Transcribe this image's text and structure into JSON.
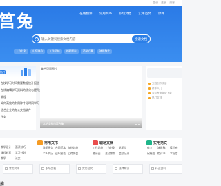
{
  "topbar": {
    "links": [
      "登录",
      "注册",
      "消息"
    ]
  },
  "header": {
    "logo": "筥兔",
    "nav": [
      "在线翻译",
      "常用文书",
      "职场文档",
      "实用范文",
      "课件"
    ]
  },
  "search": {
    "placeholder": "输入关键词搜索文档内容",
    "button_label": "搜索文档"
  },
  "hot_tags": [
    "工作计划",
    "心得体会",
    "工作总结",
    "述职报告",
    "活动方案",
    "演讲稿件"
  ],
  "left_panel": {
    "badge": "热门",
    "items": [
      "在校学习时间需要数据统计报告",
      "在线编辑学习资料的优化与提升方法",
      "教程",
      "如何高效的利用碎片化时间学习",
      "适合企业的办公文档软件",
      "任务"
    ]
  },
  "carousel": {
    "image_alt": "集合页面图片",
    "caption": "本站文档内容合集"
  },
  "right_panel": {
    "items": [
      "文档创作手册",
      "新手入门",
      "会员专享免费下载",
      "热门文档"
    ]
  },
  "categories": [
    {
      "title": "常用文书",
      "links": [
        "辞职报告",
        "合同范本",
        "年终总结",
        "个人简历",
        "述职报告",
        "心得体会"
      ]
    },
    {
      "title": "职场文档",
      "links": [
        "工作总结",
        "工作计划",
        "求职信",
        "邀请函",
        "活动策划",
        "会议记录"
      ]
    },
    {
      "title": "实用范文",
      "links": [
        "作文",
        "演讲稿",
        "读后感",
        "祝福语",
        "检讨书",
        "介绍信"
      ]
    }
  ],
  "left_column_links": [
    "教学设计",
    "面试技巧",
    "课程教案",
    "学习计划",
    "教学",
    "论文"
  ],
  "cards": [
    "常用文书",
    "职场文档",
    "实用范文",
    "法律知识",
    "行业资料"
  ],
  "bottom_mark": "推",
  "colors": {
    "brand": "#2b7fe8",
    "cat1": "#f59b23",
    "cat2": "#e94d4d",
    "cat3": "#1fb58a"
  }
}
